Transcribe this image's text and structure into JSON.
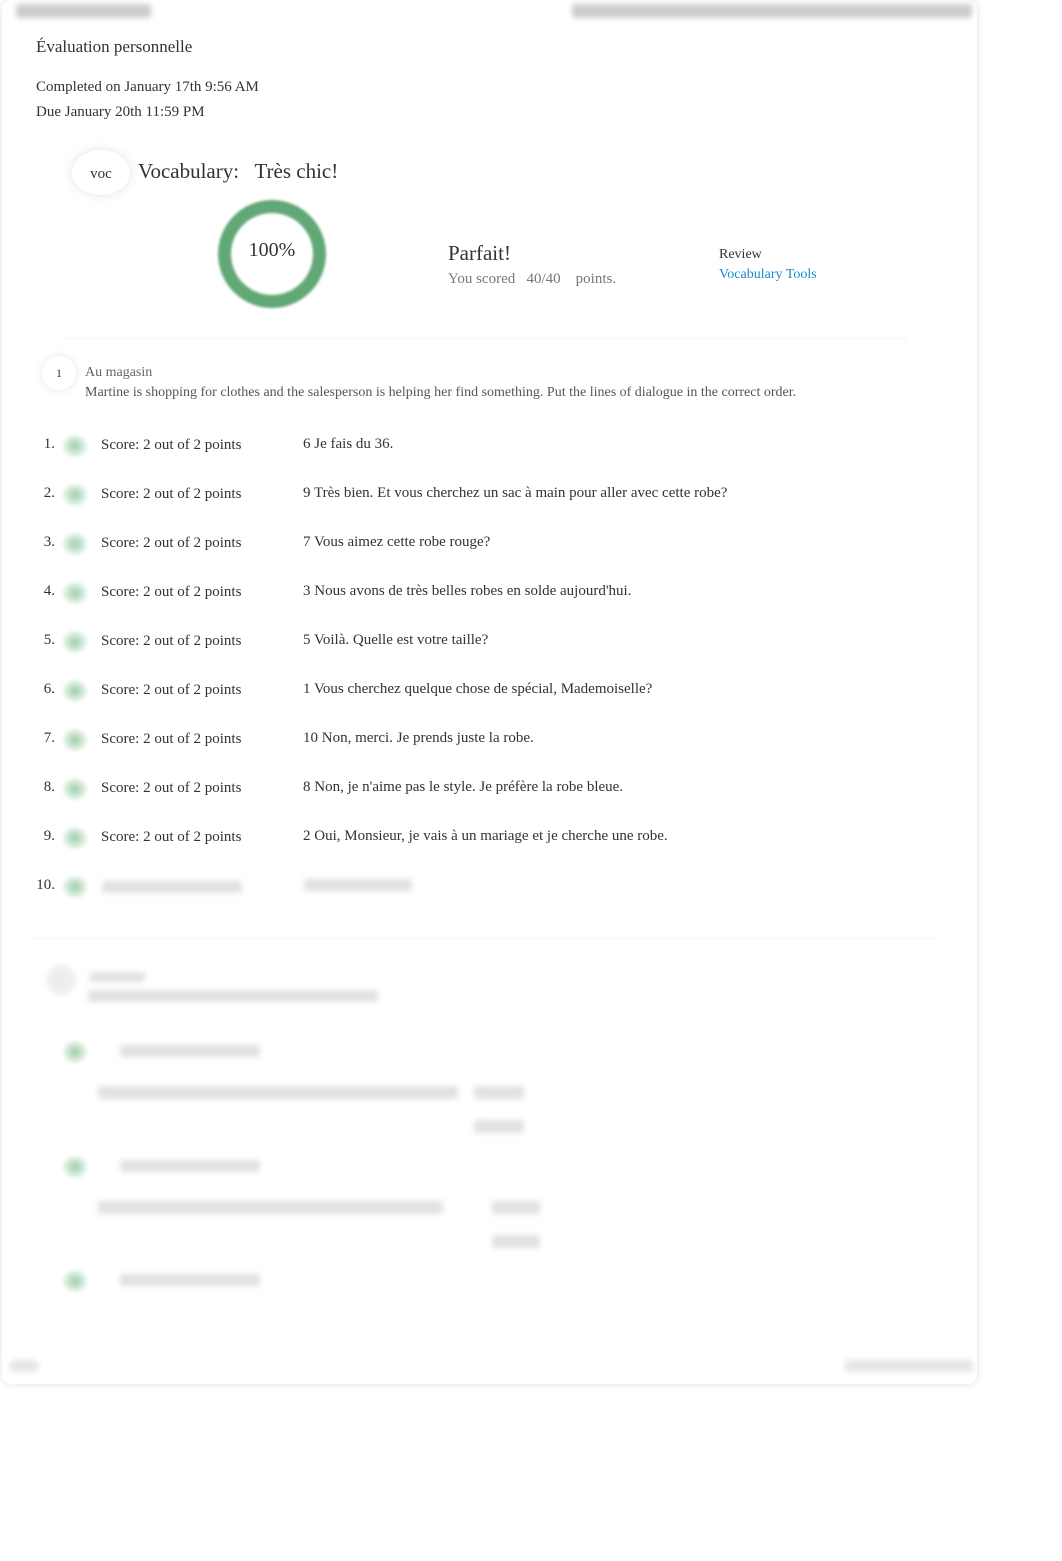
{
  "page": {
    "title": "Évaluation personnelle",
    "completed": "Completed on January 17th 9:56 AM",
    "due": "Due January 20th 11:59 PM"
  },
  "assignment": {
    "badge": "voc",
    "title": "Vocabulary:   Très chic!",
    "percent": "100%",
    "progress": 1.0,
    "result": "Parfait!",
    "scored_prefix": "You scored",
    "score": "40/40",
    "scored_suffix": "points.",
    "review_label": "Review",
    "review_link": "Vocabulary Tools",
    "ring_color": "#62a876",
    "link_color": "#1a8bd0"
  },
  "question1": {
    "number": "1",
    "title": "Au magasin",
    "instructions": "Martine is shopping for clothes and the salesperson is helping her find something. Put the lines of dialogue in the correct order.",
    "items": [
      {
        "n": "1.",
        "score": "Score: 2 out of 2 points",
        "answer": "6  Je fais du 36."
      },
      {
        "n": "2.",
        "score": "Score: 2 out of 2 points",
        "answer": "9  Très bien. Et vous cherchez un sac à main pour aller avec cette robe?"
      },
      {
        "n": "3.",
        "score": "Score: 2 out of 2 points",
        "answer": "7  Vous aimez cette robe rouge?"
      },
      {
        "n": "4.",
        "score": "Score: 2 out of 2 points",
        "answer": "3  Nous avons de très belles robes en solde aujourd'hui."
      },
      {
        "n": "5.",
        "score": "Score: 2 out of 2 points",
        "answer": "5  Voilà. Quelle est votre taille?"
      },
      {
        "n": "6.",
        "score": "Score: 2 out of 2 points",
        "answer": "1  Vous cherchez quelque chose de spécial, Mademoiselle?"
      },
      {
        "n": "7.",
        "score": "Score: 2 out of 2 points",
        "answer": "10   Non, merci. Je prends juste la robe."
      },
      {
        "n": "8.",
        "score": "Score: 2 out of 2 points",
        "answer": "8  Non, je n'aime pas le style. Je préfère la robe bleue."
      },
      {
        "n": "9.",
        "score": "Score: 2 out of 2 points",
        "answer": "2  Oui, Monsieur, je vais à un mariage et je cherche une robe."
      },
      {
        "n": "10."
      }
    ]
  }
}
